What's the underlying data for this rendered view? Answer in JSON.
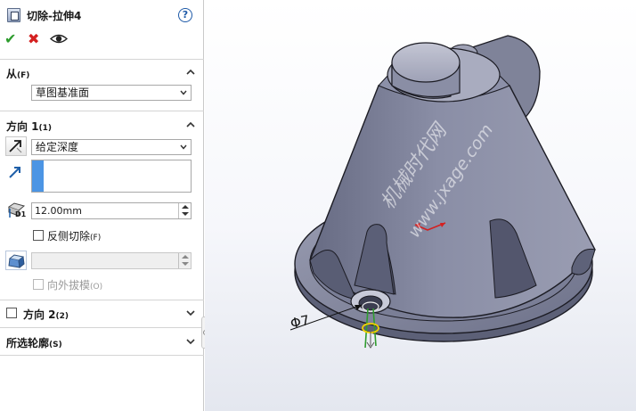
{
  "property_manager": {
    "title": "切除-拉伸4",
    "help_glyph": "?",
    "actions": {
      "ok_glyph": "✔",
      "cancel_glyph": "✖"
    }
  },
  "from_section": {
    "title": "从",
    "shortcut": "(F)",
    "selected": "草图基准面"
  },
  "direction1": {
    "title": "方向 1",
    "shortcut": "(1)",
    "end_condition": "给定深度",
    "depth_value": "12.00mm",
    "depth_icon_label": "D1",
    "flip_side_label": "反侧切除",
    "flip_side_shortcut": "(F)",
    "draft_outward_label": "向外拔模",
    "draft_outward_shortcut": "(O)"
  },
  "direction2": {
    "title": "方向 2",
    "shortcut": "(2)"
  },
  "selected_contours": {
    "title": "所选轮廓",
    "shortcut": "(S)"
  },
  "viewport": {
    "dimension_label": "Φ7",
    "watermark_cn": "机械时代网",
    "watermark_url": "www.jxage.com"
  },
  "colors": {
    "selection_accent": "#4c95e4",
    "ok": "#2e9c2e",
    "cancel": "#d42020",
    "model_body": "#7e8298"
  }
}
